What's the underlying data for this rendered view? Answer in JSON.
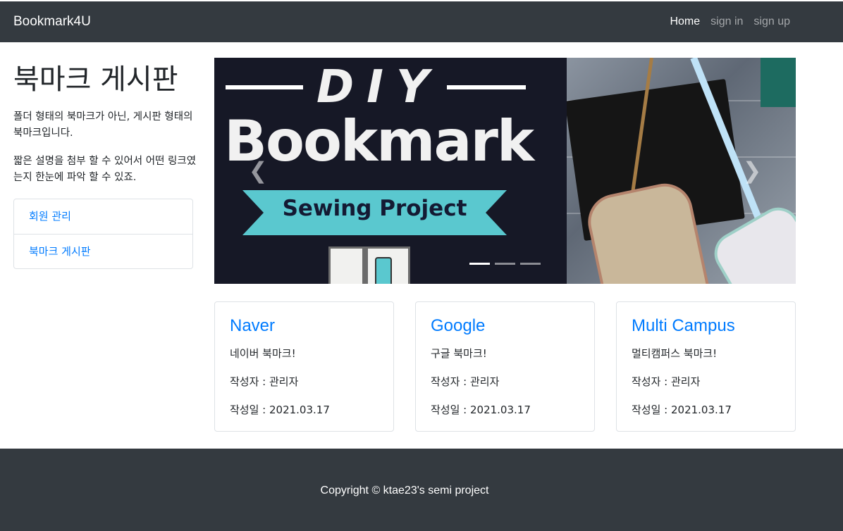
{
  "navbar": {
    "brand": "Bookmark4U",
    "links": [
      {
        "label": "Home",
        "active": true
      },
      {
        "label": "sign in",
        "active": false
      },
      {
        "label": "sign up",
        "active": false
      }
    ]
  },
  "sidebar": {
    "title": "북마크 게시판",
    "paragraph1": "폴더 형태의 북마크가 아닌, 게시판 형태의 북마크입니다.",
    "paragraph2": "짧은 설명을 첨부 할 수 있어서 어떤 링크였는지 한눈에 파악 할 수 있죠.",
    "menu": [
      {
        "label": "회원 관리"
      },
      {
        "label": "북마크 게시판"
      }
    ]
  },
  "carousel": {
    "image_text": {
      "top": "DIY",
      "main": "Bookmark",
      "banner": "Sewing Project"
    },
    "prev_icon": "chevron-left-icon",
    "next_icon": "chevron-right-icon",
    "slide_count": 3,
    "active_slide": 1
  },
  "cards": [
    {
      "title": "Naver",
      "desc": "네이버 북마크!",
      "author": "작성자 : 관리자",
      "date": "작성일 : 2021.03.17"
    },
    {
      "title": "Google",
      "desc": "구글 북마크!",
      "author": "작성자 : 관리자",
      "date": "작성일 : 2021.03.17"
    },
    {
      "title": "Multi Campus",
      "desc": "멀티캠퍼스 북마크!",
      "author": "작성자 : 관리자",
      "date": "작성일 : 2021.03.17"
    }
  ],
  "footer": {
    "copyright": "Copyright © ktae23's semi project"
  },
  "colors": {
    "navbar_bg": "#343a40",
    "link": "#007bff",
    "banner": "#5ac8cf"
  }
}
